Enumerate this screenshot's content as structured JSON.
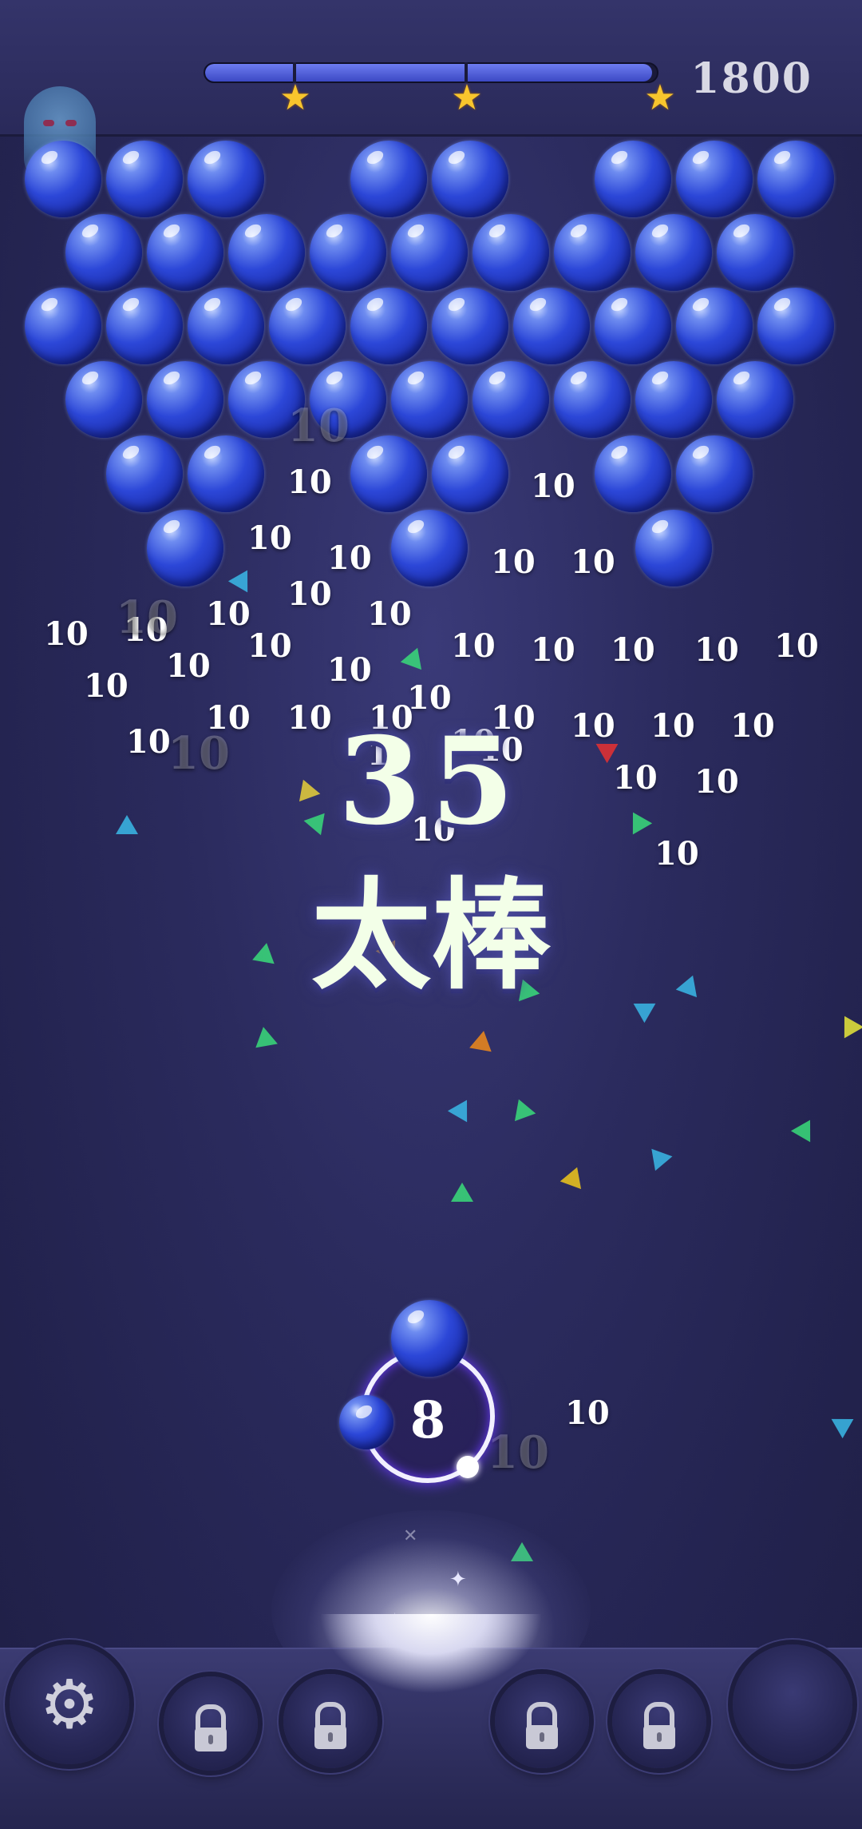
{
  "hud": {
    "progress_fraction": 0.99,
    "stars_earned": 3,
    "score": "1800"
  },
  "board": {
    "bubble_color": "#2c47d8",
    "popped_points": [
      "10",
      "10",
      "10",
      "10",
      "10",
      "10",
      "10",
      "10",
      "10",
      "10",
      "10",
      "10",
      "10",
      "10",
      "10",
      "10",
      "10",
      "10",
      "10",
      "10",
      "10",
      "10",
      "10",
      "10",
      "10",
      "10",
      "10",
      "10",
      "10",
      "10",
      "10",
      "10",
      "10",
      "10",
      "10",
      "10",
      "10",
      "10",
      "10",
      "10",
      "10"
    ]
  },
  "combo": {
    "count": "35",
    "praise": "太棒"
  },
  "shooter": {
    "shots_left": "8",
    "current_bubble_color": "#2c47d8",
    "next_bubble_color": "#2c47d8"
  },
  "toolbar": {
    "settings_icon": "gear-icon",
    "locked_slots": 4,
    "lock_icon": "lock-icon"
  },
  "colors": {
    "background": "#2b2b5e",
    "star": "#f8c52d",
    "ring": "#f2f0ff"
  }
}
